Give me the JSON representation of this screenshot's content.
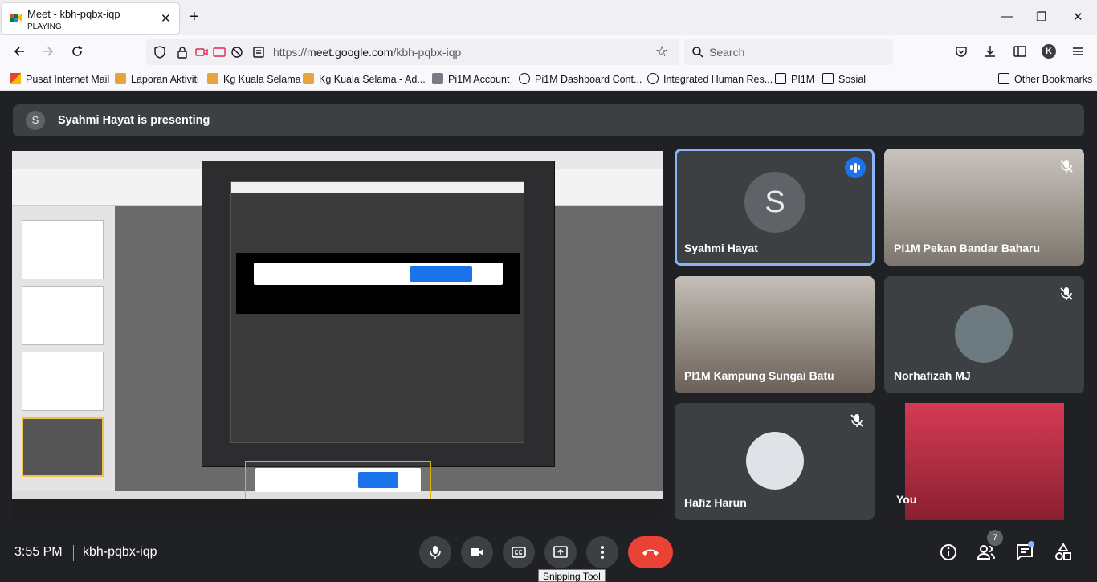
{
  "browser": {
    "tab": {
      "title": "Meet - kbh-pqbx-iqp",
      "subtitle": "PLAYING"
    },
    "url": {
      "prefix": "https://",
      "host": "meet.google.com",
      "path": "/kbh-pqbx-iqp"
    },
    "search_placeholder": "Search",
    "profile_initial": "K",
    "bookmarks": [
      {
        "label": "Pusat Internet Mail",
        "icon": "gmail-icon"
      },
      {
        "label": "Laporan Aktiviti",
        "icon": "app-icon"
      },
      {
        "label": "Kg Kuala Selama",
        "icon": "app-icon"
      },
      {
        "label": "Kg Kuala Selama - Ad...",
        "icon": "app-icon"
      },
      {
        "label": "Pi1M Account",
        "icon": "app-icon"
      },
      {
        "label": "Pi1M Dashboard Cont...",
        "icon": "globe-icon"
      },
      {
        "label": "Integrated Human Res...",
        "icon": "globe-icon"
      },
      {
        "label": "PI1M",
        "icon": "folder-icon"
      },
      {
        "label": "Sosial",
        "icon": "folder-icon"
      }
    ],
    "other_bookmarks": "Other Bookmarks"
  },
  "meet": {
    "presenting_initial": "S",
    "presenting_text": "Syahmi Hayat is presenting",
    "participants": [
      {
        "name": "Syahmi Hayat",
        "initial": "S",
        "speaking": true
      },
      {
        "name": "PI1M Pekan Bandar Baharu",
        "muted": true
      },
      {
        "name": "PI1M Kampung Sungai Batu",
        "muted": false
      },
      {
        "name": "Norhafizah MJ",
        "muted": true
      },
      {
        "name": "Hafiz Harun",
        "muted": true
      },
      {
        "name": "You",
        "muted": false
      }
    ],
    "time": "3:55 PM",
    "meeting_code": "kbh-pqbx-iqp",
    "people_count": "7",
    "tooltip": "Snipping Tool"
  },
  "colors": {
    "accent": "#8ab4f8",
    "end_call": "#ea4335",
    "speaking_badge": "#1a73e8"
  }
}
